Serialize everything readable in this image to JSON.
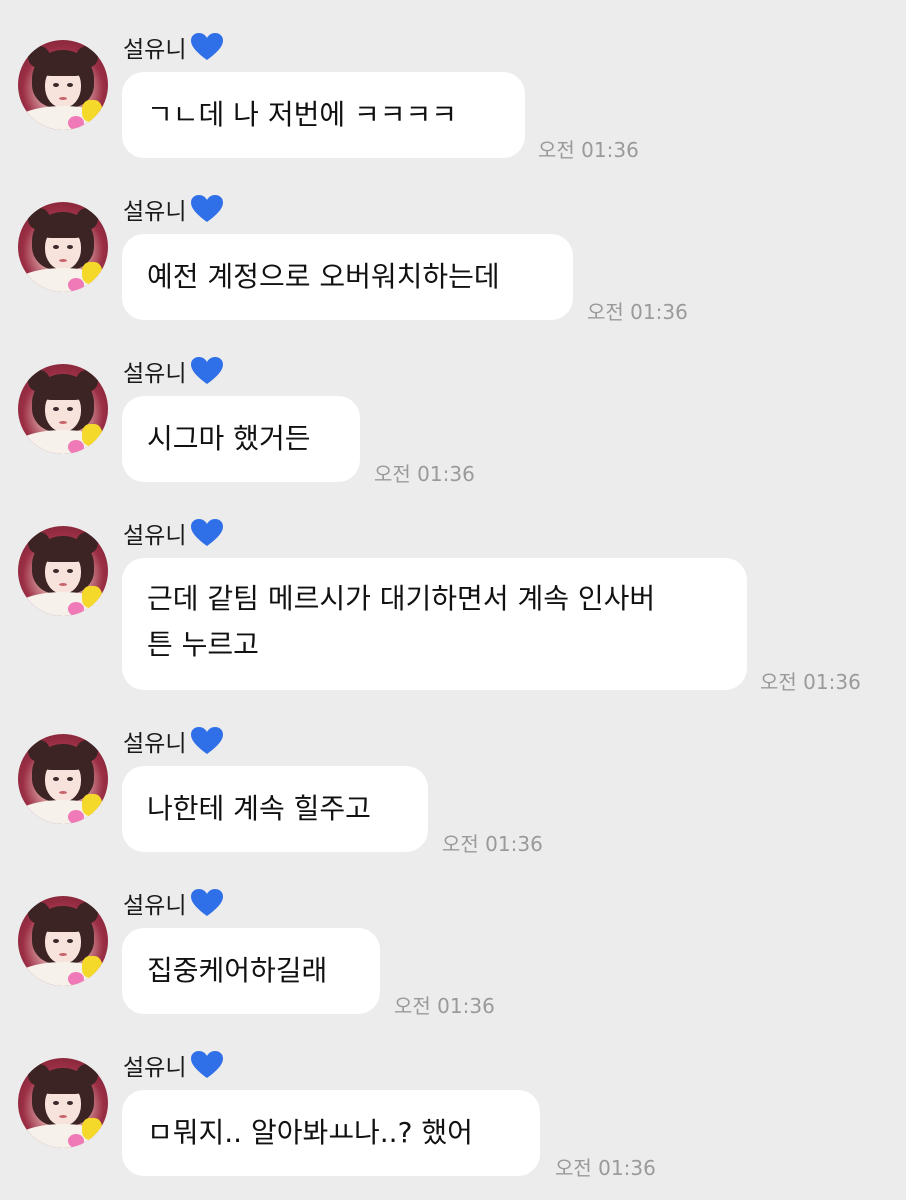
{
  "colors": {
    "background": "#ececec",
    "bubble": "#ffffff",
    "heart": "#2f6fe8",
    "timestamp": "#9a9a9a"
  },
  "messages": [
    {
      "sender": "설유니",
      "heart_icon": "blue-heart-icon",
      "lines": [
        "ㄱㄴ데 나 저번에 ㅋㅋㅋㅋ"
      ],
      "time": "오전 01:36"
    },
    {
      "sender": "설유니",
      "heart_icon": "blue-heart-icon",
      "lines": [
        "예전 계정으로 오버워치하는데"
      ],
      "time": "오전 01:36"
    },
    {
      "sender": "설유니",
      "heart_icon": "blue-heart-icon",
      "lines": [
        "시그마 했거든"
      ],
      "time": "오전 01:36"
    },
    {
      "sender": "설유니",
      "heart_icon": "blue-heart-icon",
      "lines": [
        "근데 같팀 메르시가 대기하면서 계속 인사버",
        "튼 누르고"
      ],
      "time": "오전 01:36"
    },
    {
      "sender": "설유니",
      "heart_icon": "blue-heart-icon",
      "lines": [
        "나한테 계속 힐주고"
      ],
      "time": "오전 01:36"
    },
    {
      "sender": "설유니",
      "heart_icon": "blue-heart-icon",
      "lines": [
        "집중케어하길래"
      ],
      "time": "오전 01:36"
    },
    {
      "sender": "설유니",
      "heart_icon": "blue-heart-icon",
      "lines": [
        "ㅁ뭐지.. 알아봐ㅛ나..? 했어"
      ],
      "time": "오전 01:36"
    }
  ]
}
